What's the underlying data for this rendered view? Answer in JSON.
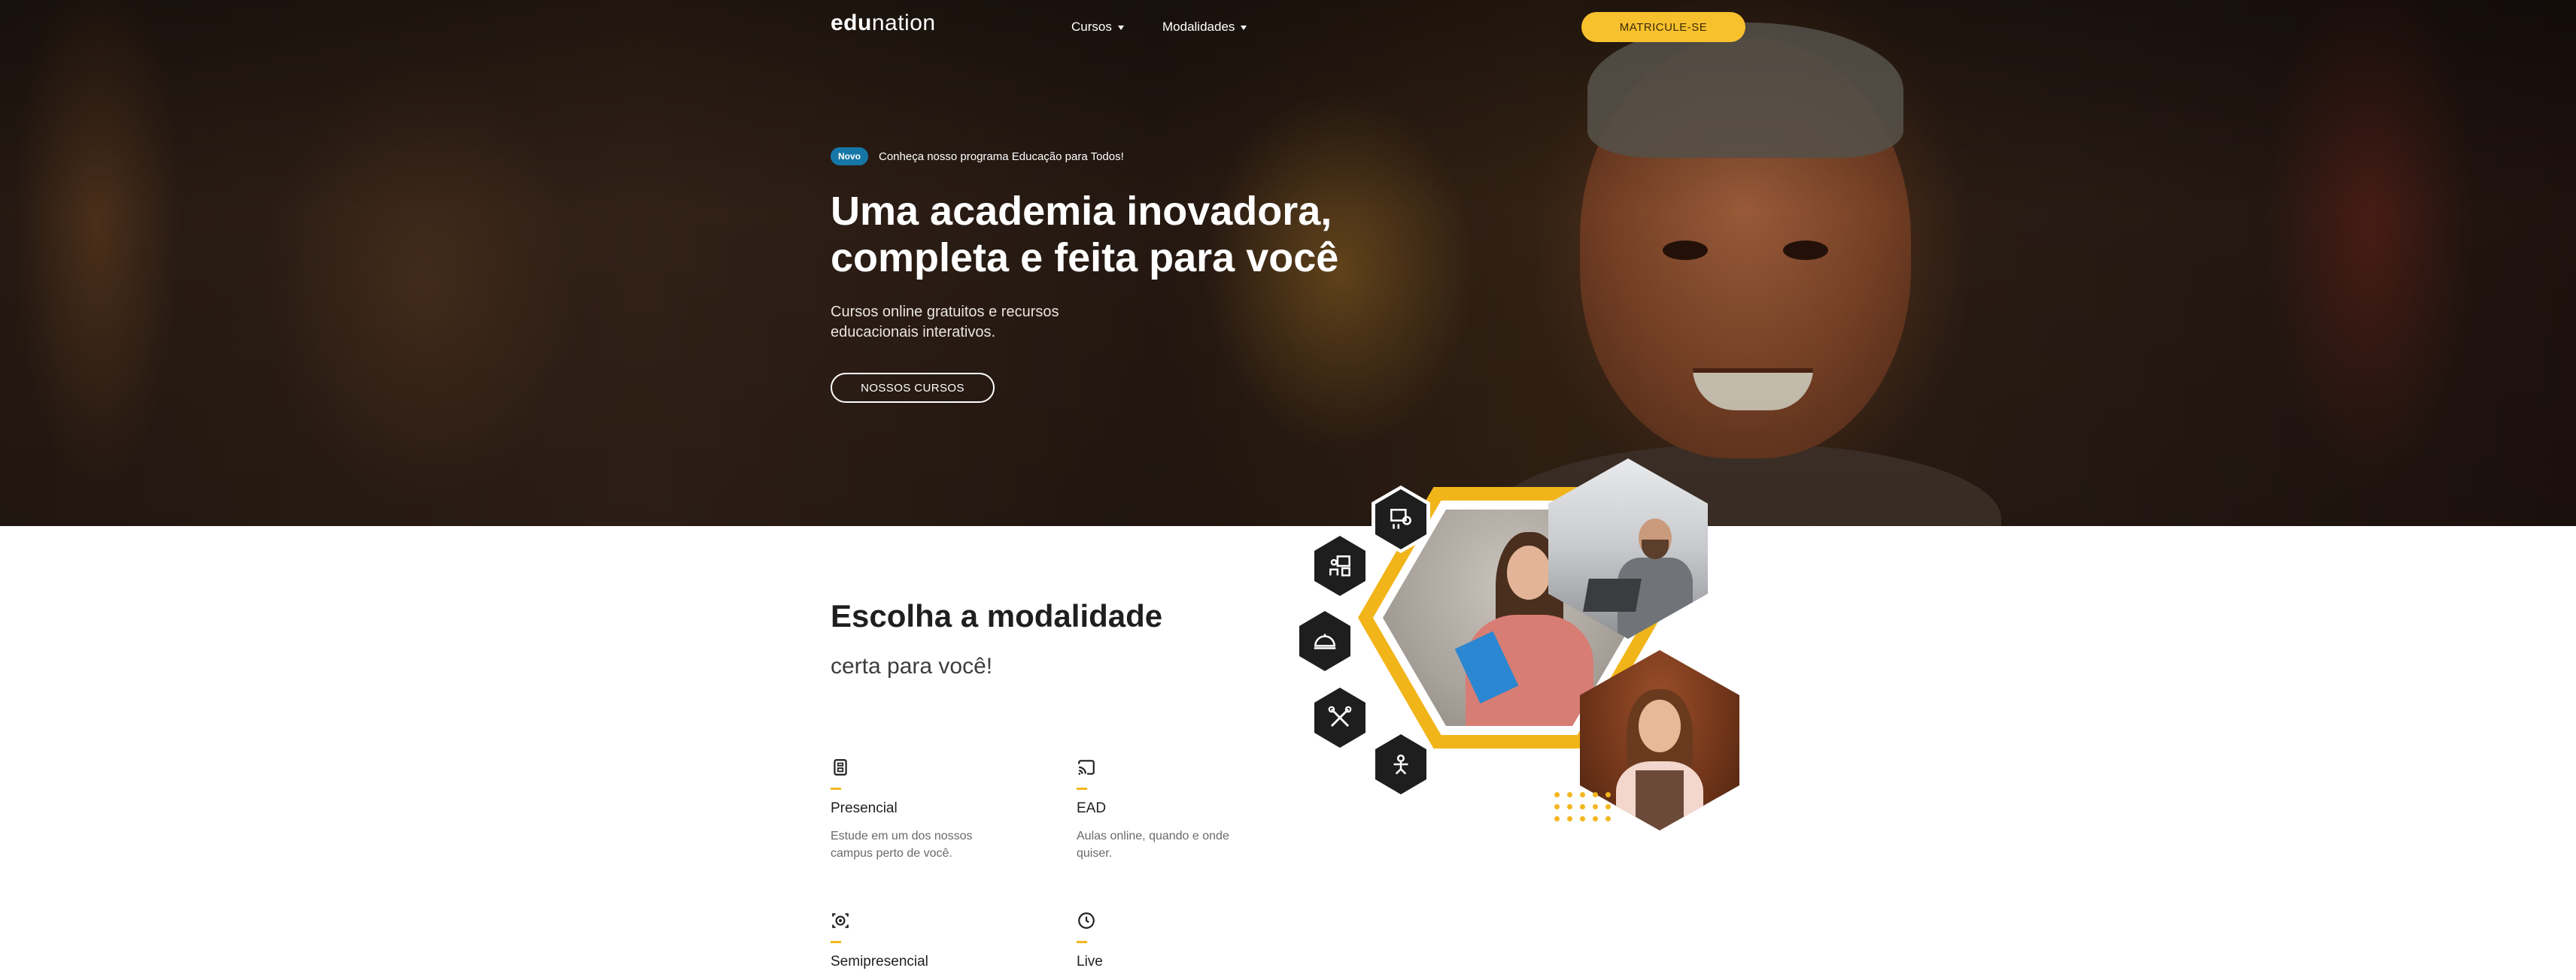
{
  "brand": {
    "logo_bold": "edu",
    "logo_light": "nation"
  },
  "nav": {
    "items": [
      {
        "label": "Cursos"
      },
      {
        "label": "Modalidades"
      }
    ],
    "cta_label": "MATRICULE-SE"
  },
  "hero": {
    "badge": "Novo",
    "announcement": "Conheça nosso programa Educação para Todos!",
    "title_line1": "Uma academia inovadora,",
    "title_line2": "completa e feita para você",
    "subtitle_line1": "Cursos online gratuitos e recursos",
    "subtitle_line2": "educacionais interativos.",
    "button_label": "NOSSOS CURSOS"
  },
  "section": {
    "title": "Escolha a modalidade",
    "subtitle": "certa para você!",
    "modalities": [
      {
        "icon": "building-icon",
        "name": "Presencial",
        "description": "Estude em um dos nossos campus perto de você."
      },
      {
        "icon": "cast-icon",
        "name": "EAD",
        "description": "Aulas online, quando e onde quiser."
      },
      {
        "icon": "hybrid-icon",
        "name": "Semipresencial",
        "description": ""
      },
      {
        "icon": "clock-icon",
        "name": "Live",
        "description": ""
      }
    ]
  },
  "cluster_icons": [
    "presentation-icon",
    "teacher-board-icon",
    "cloche-icon",
    "tools-icon",
    "engineering-icon"
  ],
  "colors": {
    "accent": "#f7c12e",
    "badge": "#1677a7",
    "ring": "#f1b51a"
  }
}
